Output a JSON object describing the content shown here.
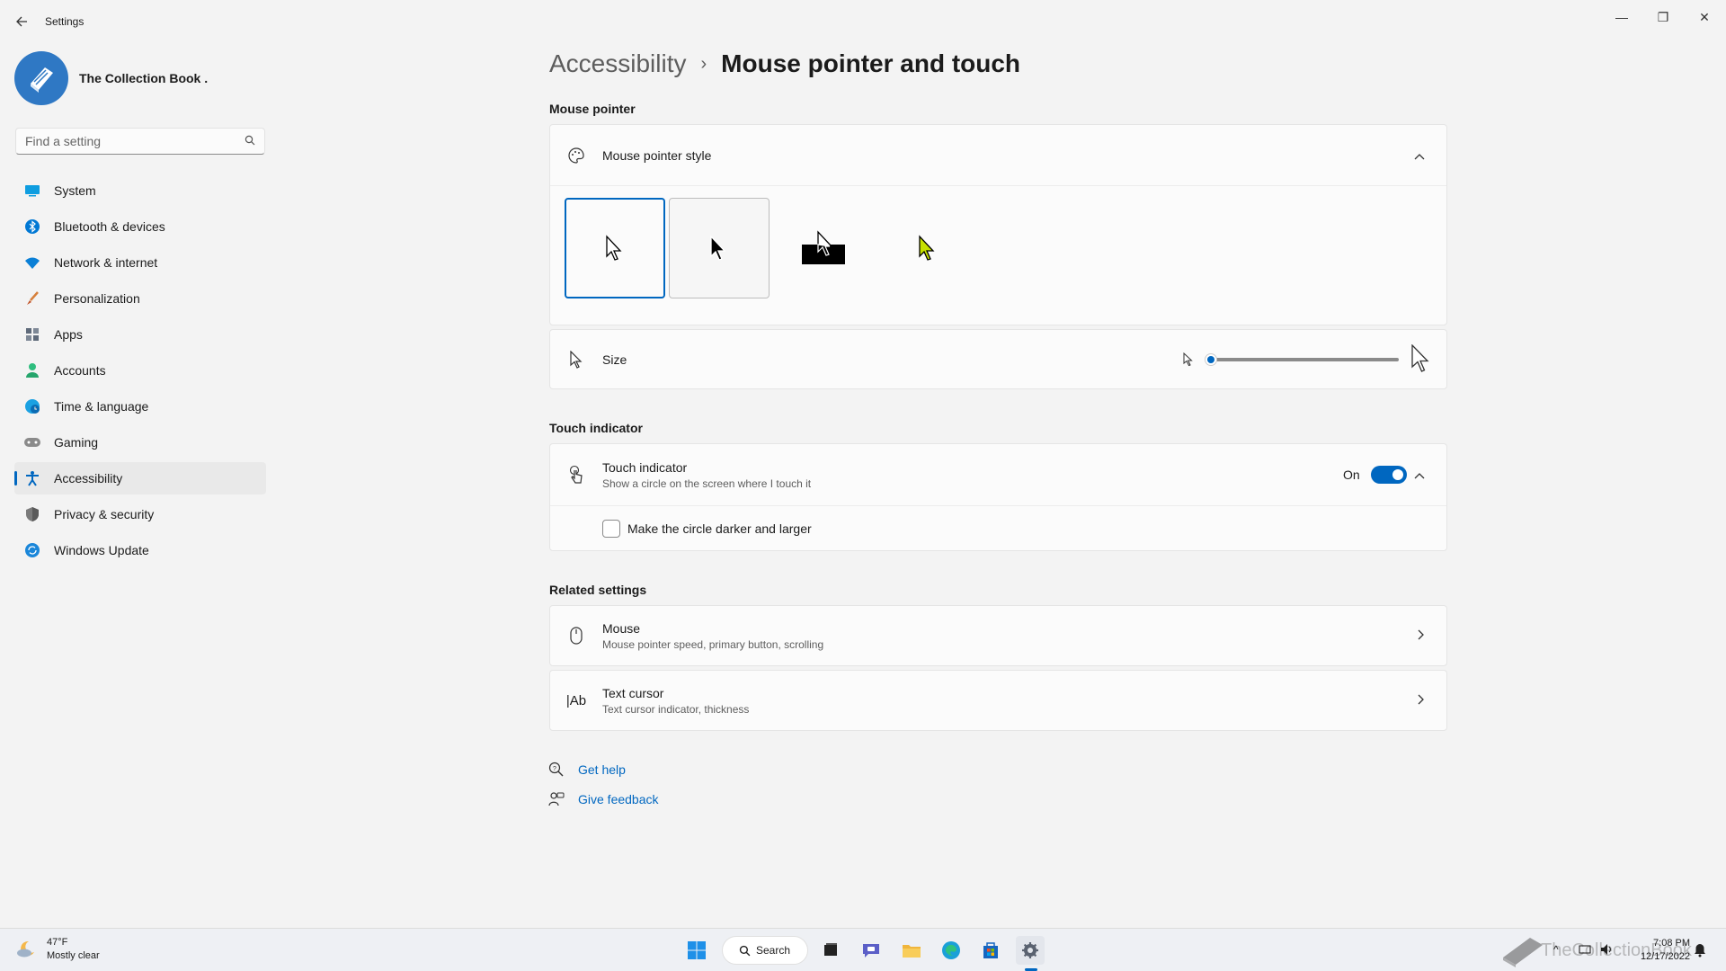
{
  "window": {
    "title": "Settings",
    "controls": {
      "minimize": "—",
      "maximize": "❐",
      "close": "✕"
    }
  },
  "profile": {
    "name": "The Collection Book ."
  },
  "search": {
    "placeholder": "Find a setting"
  },
  "sidebar": {
    "items": [
      {
        "label": "System",
        "icon": "system-icon",
        "color": "#0078d4"
      },
      {
        "label": "Bluetooth & devices",
        "icon": "bluetooth-icon",
        "color": "#0078d4"
      },
      {
        "label": "Network & internet",
        "icon": "wifi-icon",
        "color": "#0078d4"
      },
      {
        "label": "Personalization",
        "icon": "brush-icon",
        "color": "#d67f3b"
      },
      {
        "label": "Apps",
        "icon": "apps-icon",
        "color": "#5f6a7a"
      },
      {
        "label": "Accounts",
        "icon": "accounts-icon",
        "color": "#2ebd7e"
      },
      {
        "label": "Time & language",
        "icon": "globe-clock-icon",
        "color": "#0b8fd0"
      },
      {
        "label": "Gaming",
        "icon": "gamepad-icon",
        "color": "#7a7a7a"
      },
      {
        "label": "Accessibility",
        "icon": "accessibility-icon",
        "color": "#0067c0",
        "active": true
      },
      {
        "label": "Privacy & security",
        "icon": "shield-icon",
        "color": "#6b6b6b"
      },
      {
        "label": "Windows Update",
        "icon": "update-icon",
        "color": "#0b74d0"
      }
    ]
  },
  "breadcrumb": {
    "parent": "Accessibility",
    "separator": "›",
    "current": "Mouse pointer and touch"
  },
  "mouse_pointer": {
    "section_label": "Mouse pointer",
    "style": {
      "label": "Mouse pointer style",
      "expanded": true,
      "selected_index": 0,
      "options": [
        "white",
        "black",
        "inverted",
        "custom"
      ]
    },
    "size": {
      "label": "Size",
      "value": 1
    }
  },
  "touch": {
    "section_label": "Touch indicator",
    "indicator": {
      "title": "Touch indicator",
      "subtitle": "Show a circle on the screen where I touch it",
      "state": "On",
      "enabled": true
    },
    "darker": {
      "label": "Make the circle darker and larger",
      "checked": false
    }
  },
  "related": {
    "section_label": "Related settings",
    "items": [
      {
        "title": "Mouse",
        "subtitle": "Mouse pointer speed, primary button, scrolling",
        "icon": "mouse-icon"
      },
      {
        "title": "Text cursor",
        "subtitle": "Text cursor indicator, thickness",
        "icon": "text-cursor-icon",
        "glyph": "|Ab"
      }
    ]
  },
  "help": {
    "get_help": "Get help",
    "feedback": "Give feedback"
  },
  "taskbar": {
    "weather": {
      "temp": "47°F",
      "condition": "Mostly clear"
    },
    "search_label": "Search",
    "time": "7:08 PM",
    "date": "12/17/2022",
    "watermark": "TheCollectionBook"
  },
  "colors": {
    "accent": "#0067c0",
    "background": "#f3f3f3",
    "card": "#fbfbfb"
  }
}
